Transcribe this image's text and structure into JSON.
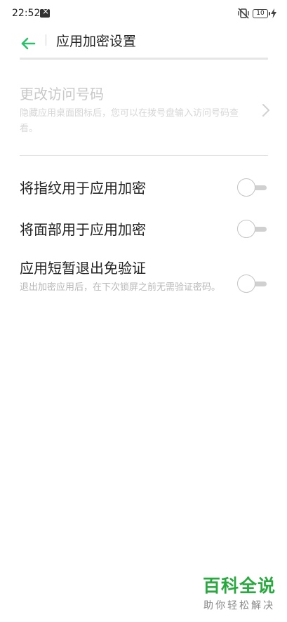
{
  "status_bar": {
    "time": "22:52",
    "battery_level": "10",
    "icons": [
      "notification-icon",
      "vibrate-off-icon",
      "battery-icon",
      "charging-icon"
    ]
  },
  "header": {
    "title": "应用加密设置",
    "back_icon": "arrow-left-icon"
  },
  "colors": {
    "accent": "#2ebd6b",
    "watermark": "#2aa840"
  },
  "settings": {
    "access_code": {
      "title": "更改访问号码",
      "description": "隐藏应用桌面图标后，您可以在拨号盘输入访问号码查看。",
      "enabled": false
    },
    "fingerprint": {
      "title": "将指纹用于应用加密",
      "on": false
    },
    "face": {
      "title": "将面部用于应用加密",
      "on": false
    },
    "skip_verify": {
      "title": "应用短暂退出免验证",
      "description": "退出加密应用后，在下次锁屏之前无需验证密码。",
      "on": false
    }
  },
  "watermark": {
    "main": "百科全说",
    "sub": "助你轻松解决"
  }
}
